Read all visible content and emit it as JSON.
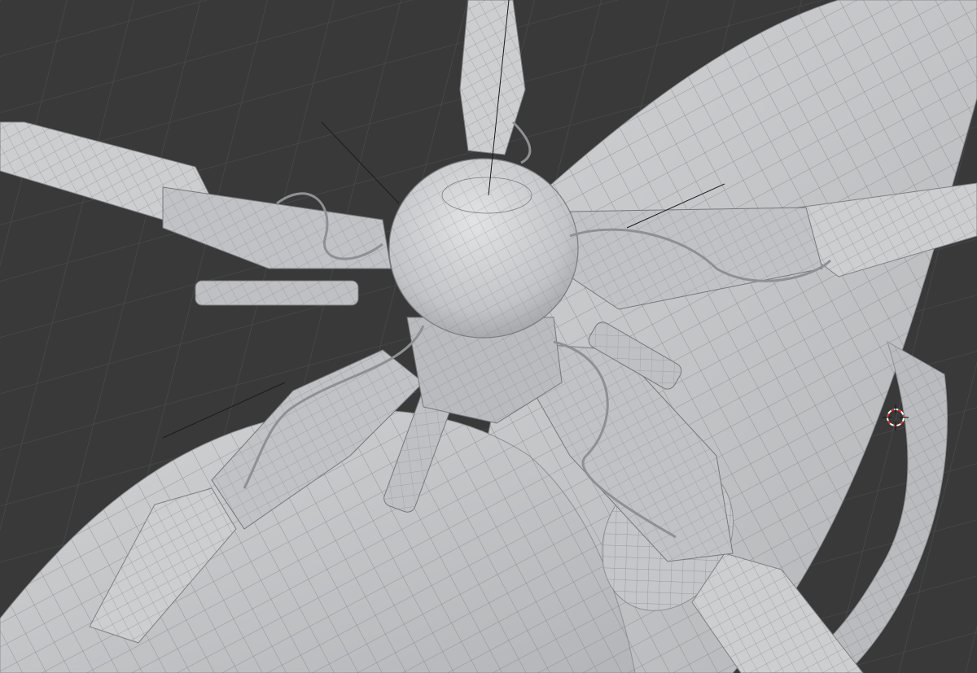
{
  "viewport": {
    "mode": "wireframe-overlay",
    "background_color": "#393939",
    "grid_color": "#4a4a4a",
    "mesh_fill_color": "#c9cacc",
    "mesh_shade_color": "#a9abae",
    "mesh_wire_color": "#6f7174",
    "origin_line_color": "#1c1c1c",
    "cursor_colors": [
      "#e23b2b",
      "#ffffff"
    ]
  },
  "icons": {
    "3d_cursor": "3d-cursor-icon"
  }
}
